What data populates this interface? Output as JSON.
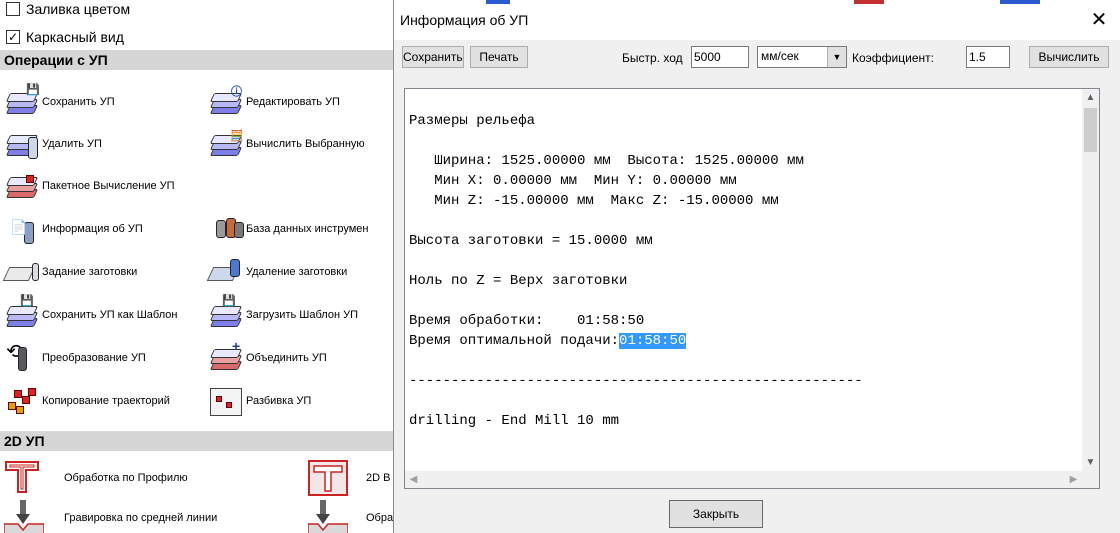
{
  "left_panel": {
    "checkboxes": [
      {
        "label": "Заливка цветом",
        "checked": false
      },
      {
        "label": "Каркасный вид",
        "checked": true
      }
    ],
    "sections": {
      "operations": "Операции с УП",
      "two_d": "2D УП"
    },
    "operations": [
      {
        "label": "Сохранить УП",
        "icon": "save-toolpath-icon"
      },
      {
        "label": "Редактировать УП",
        "icon": "edit-toolpath-icon"
      },
      {
        "label": "Удалить УП",
        "icon": "delete-toolpath-icon"
      },
      {
        "label": "Вычислить Выбранную",
        "icon": "calculate-selected-icon"
      },
      {
        "label": "Пакетное Вычисление УП",
        "icon": "batch-calculate-icon"
      },
      {
        "label": "Информация об УП",
        "icon": "toolpath-info-icon"
      },
      {
        "label": "База данных инструмен",
        "icon": "tool-database-icon"
      },
      {
        "label": "Задание заготовки",
        "icon": "set-material-icon"
      },
      {
        "label": "Удаление заготовки",
        "icon": "remove-material-icon"
      },
      {
        "label": "Сохранить УП как Шаблон",
        "icon": "save-template-icon"
      },
      {
        "label": "Загрузить Шаблон УП",
        "icon": "load-template-icon"
      },
      {
        "label": "Преобразование УП",
        "icon": "transform-toolpath-icon"
      },
      {
        "label": "Объединить УП",
        "icon": "merge-toolpaths-icon"
      },
      {
        "label": "Копирование траекторий",
        "icon": "copy-toolpaths-icon"
      },
      {
        "label": "Разбивка УП",
        "icon": "split-toolpath-icon"
      }
    ],
    "two_d_items": [
      {
        "label": "Обработка по Профилю",
        "icon": "profile-machining-icon"
      },
      {
        "label": "2D В",
        "icon": "2d-pocket-icon"
      },
      {
        "label": "Гравировка по средней линии",
        "icon": "centerline-engraving-icon"
      },
      {
        "label": "Обра",
        "icon": "machining-icon"
      }
    ]
  },
  "dialog": {
    "title": "Информация об УП",
    "close_glyph": "✕",
    "toolbar": {
      "save_label": "Сохранить",
      "print_label": "Печать",
      "rapid_label": "Быстр. ход",
      "rapid_value": "5000",
      "unit_value": "мм/сек",
      "factor_label": "Коэффициент:",
      "factor_value": "1.5",
      "calculate_label": "Вычислить"
    },
    "report": {
      "lines": [
        "Размеры рельефа",
        "",
        "   Ширина: 1525.00000 мм  Высота: 1525.00000 мм",
        "   Мин X: 0.00000 мм  Мин Y: 0.00000 мм",
        "   Мин Z: -15.00000 мм  Макс Z: -15.00000 мм",
        "",
        "Высота заготовки = 15.0000 мм",
        "",
        "Ноль по Z = Верх заготовки",
        "",
        "Время обработки:    01:58:50"
      ],
      "optimal_label": "Время оптимальной подачи:",
      "optimal_value": "01:58:50",
      "separator": "------------------------------------------------------",
      "tool_line": "drilling - End Mill 10 mm"
    },
    "close_button": "Закрыть"
  }
}
